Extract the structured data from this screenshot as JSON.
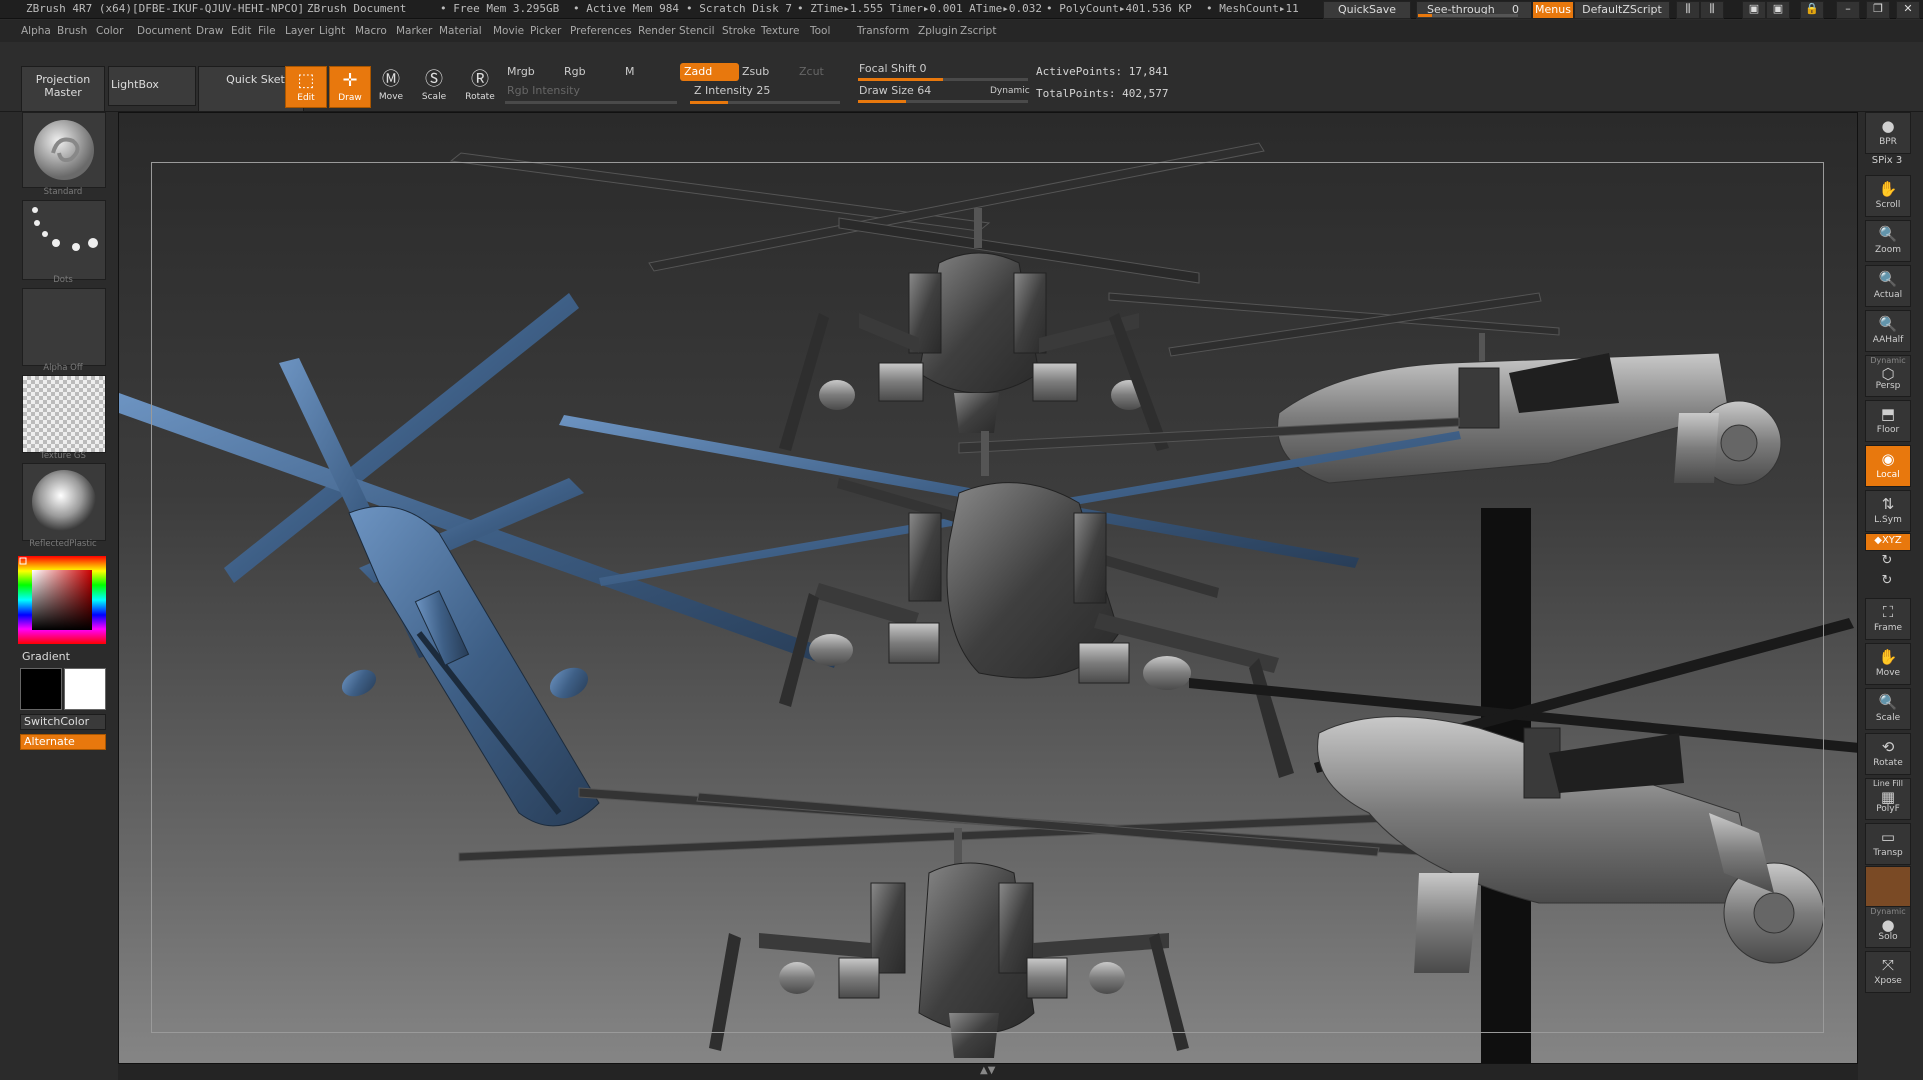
{
  "titlebar": {
    "app": "ZBrush 4R7 (x64)[DFBE-IKUF-QJUV-HEHI-NPCO]",
    "document": "ZBrush Document",
    "free_mem": "• Free Mem 3.295GB",
    "active_mem": "• Active Mem 984",
    "scratch_disk": "• Scratch Disk 7",
    "ztime": "• ZTime▸1.555 Timer▸0.001 ATime▸0.032",
    "polycount": "• PolyCount▸401.536 KP",
    "meshcount": "• MeshCount▸11",
    "quicksave": "QuickSave",
    "see_through": "See-through",
    "see_through_value": "0",
    "see_through_fraction": 0.0,
    "menus": "Menus",
    "default_zscript": "DefaultZScript"
  },
  "menu": [
    "Alpha",
    "Brush",
    "Color",
    "Document",
    "Draw",
    "Edit",
    "File",
    "Layer",
    "Light",
    "Macro",
    "Marker",
    "Material",
    "Movie",
    "Picker",
    "Preferences",
    "Render",
    "Stencil",
    "Stroke",
    "Texture",
    "Tool",
    "Transform",
    "Zplugin",
    "Zscript"
  ],
  "toolbar": {
    "projection_master": "Projection Master",
    "lightbox": "LightBox",
    "quick_sketch": "Quick Sketch",
    "edit": "Edit",
    "draw": "Draw",
    "move": "Move",
    "scale": "Scale",
    "rotate": "Rotate",
    "mrgb": "Mrgb",
    "rgb": "Rgb",
    "m": "M",
    "rgb_intensity": "Rgb Intensity",
    "zadd": "Zadd",
    "zsub": "Zsub",
    "zcut": "Zcut",
    "z_intensity": "Z Intensity 25",
    "z_intensity_fraction": 0.25,
    "focal_shift": "Focal Shift 0",
    "focal_shift_fraction": 0.5,
    "draw_size": "Draw Size 64",
    "draw_size_fraction": 0.06,
    "dynamic": "Dynamic",
    "active_points": "ActivePoints: 17,841",
    "total_points": "TotalPoints: 402,577"
  },
  "leftshelf": {
    "brush": "Standard",
    "stroke": "Dots",
    "alpha": "Alpha Off",
    "texture": "Texture GS",
    "material": "ReflectedPlastic",
    "gradient": "Gradient",
    "switch_color": "SwitchColor",
    "alternate": "Alternate"
  },
  "rightshelf": {
    "bpr": "BPR",
    "spix": "SPix 3",
    "scroll": "Scroll",
    "zoom": "Zoom",
    "actual": "Actual",
    "aahalf": "AAHalf",
    "dynamic": "Dynamic",
    "persp": "Persp",
    "floor": "Floor",
    "local": "Local",
    "lsym": "L.Sym",
    "xyz": "◆XYZ",
    "frame": "Frame",
    "move": "Move",
    "scale": "Scale",
    "rotate": "Rotate",
    "line_fill": "Line Fill",
    "polyf": "PolyF",
    "transp": "Transp",
    "dynamic2": "Dynamic",
    "solo": "Solo",
    "xpose": "Xpose"
  },
  "colors": {
    "accent": "#e8780d",
    "model_metal": "#5a5a5a",
    "model_blue": "#4f79a8"
  }
}
